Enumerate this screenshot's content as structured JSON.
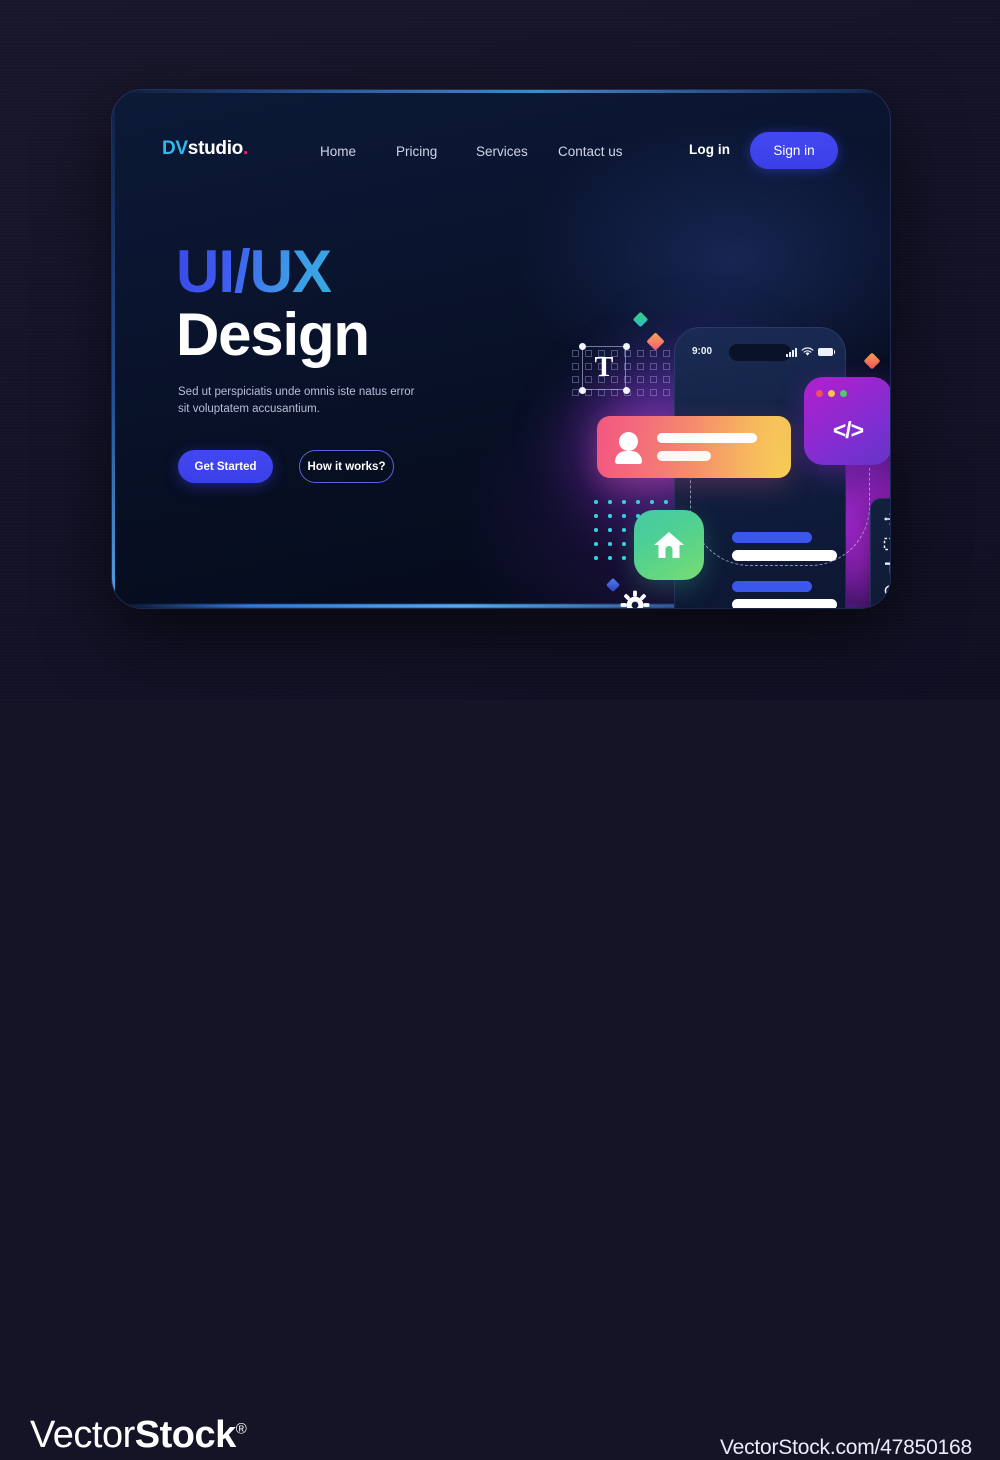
{
  "page": {
    "background_color": "#141426",
    "card_background": "#0a1530"
  },
  "navbar": {
    "logo": {
      "dv": "DV",
      "studio": "studio",
      "dot": "."
    },
    "links": [
      {
        "label": "Home"
      },
      {
        "label": "Pricing"
      },
      {
        "label": "Services"
      },
      {
        "label": "Contact us"
      }
    ],
    "login_label": "Log in",
    "signin_label": "Sign in",
    "signin_color": "#3f43ea"
  },
  "hero": {
    "headline_line1": "UI/UX",
    "headline_line2": "Design",
    "headline_gradient_from": "#3949e8",
    "headline_gradient_to": "#38a8e2",
    "subcopy": "Sed ut perspiciatis unde omnis iste natus error sit voluptatem accusantium.",
    "primary_button": "Get Started",
    "secondary_button": "How it works?"
  },
  "illustration": {
    "phone": {
      "time": "9:00",
      "signal_icon": "signal-bars-icon",
      "wifi_icon": "wifi-icon",
      "battery_icon": "battery-icon"
    },
    "text_tool": {
      "glyph": "T",
      "name": "text-tool-selection"
    },
    "code_window": {
      "glyph": "</>",
      "dots": [
        "#f0505f",
        "#f5c24a",
        "#4fc96a"
      ],
      "gradient_from": "#b21fd0",
      "gradient_to": "#6634c6"
    },
    "profile_card": {
      "avatar_icon": "user-avatar-icon",
      "gradient_from": "#f2577f",
      "gradient_to": "#f8cf55"
    },
    "home_app": {
      "icon": "home-icon",
      "gradient_from": "#46c9a4",
      "gradient_to": "#79dd74"
    },
    "play_button": {
      "icon": "play-icon",
      "color": "#f0414f"
    },
    "gear": {
      "icon": "gear-icon"
    },
    "toolbar": {
      "items": [
        {
          "icon": "move-icon"
        },
        {
          "icon": "marquee-select-icon"
        },
        {
          "icon": "text-icon"
        },
        {
          "icon": "magnifier-icon"
        },
        {
          "icon": "layers-icon"
        }
      ]
    }
  },
  "footer": {
    "brand_thin": "Vector",
    "brand_bold": "Stock",
    "registered": "®",
    "url": "VectorStock.com/47850168"
  }
}
